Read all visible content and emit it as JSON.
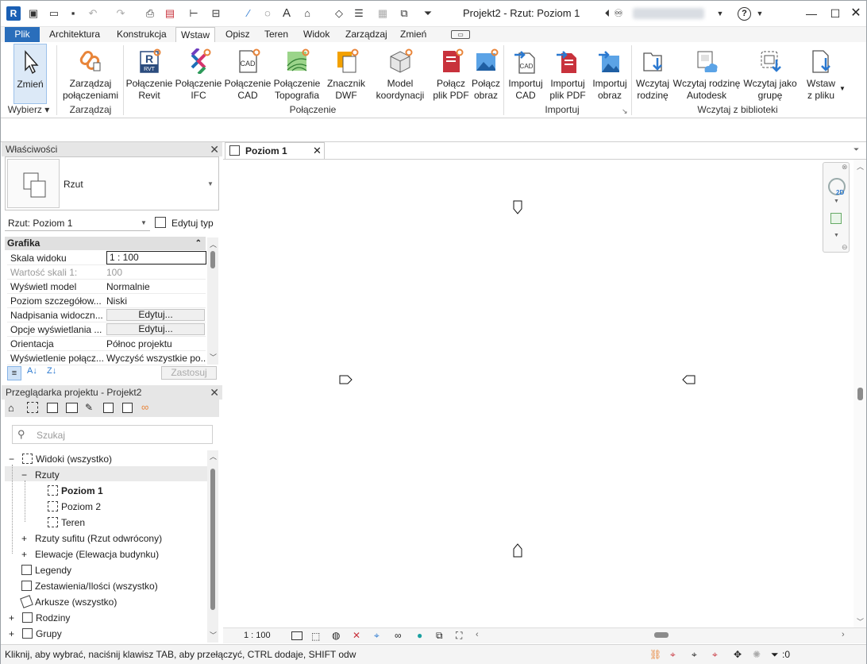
{
  "titlebar": {
    "app_badge": "R",
    "title": "Projekt2 - Rzut: Poziom 1",
    "help_symbol": "?",
    "text_tool_letter": "A"
  },
  "ribbon_tabs": [
    "Plik",
    "Architektura",
    "Konstrukcja",
    "Wstaw",
    "Opisz",
    "Teren",
    "Widok",
    "Zarządzaj",
    "Zmień"
  ],
  "active_tab": "Wstaw",
  "ribbon": {
    "buttons": {
      "modify": "Zmień",
      "manage_links": "Zarządzaj\npołączeniami",
      "link_revit": "Połączenie\nRevit",
      "link_ifc": "Połączenie\nIFC",
      "link_cad": "Połączenie\nCAD",
      "link_topo": "Połączenie\nTopografia",
      "dwf_markup": "Znacznik\nDWF",
      "coord_model": "Model\nkoordynacji",
      "link_pdf": "Połącz\nplik PDF",
      "link_image": "Połącz\nobraz",
      "import_cad": "Importuj\nCAD",
      "import_pdf": "Importuj\nplik PDF",
      "import_image": "Importuj\nobraz",
      "load_family": "Wczytaj\nrodzinę",
      "load_autodesk": "Wczytaj rodzinę\nAutodesk",
      "load_group": "Wczytaj jako\ngrupę",
      "insert_file": "Wstaw\nz pliku"
    },
    "groups": {
      "select": "Wybierz",
      "manage": "Zarządzaj",
      "link": "Połączenie",
      "import": "Importuj",
      "library": "Wczytaj z biblioteki"
    },
    "icon_text": {
      "rvt": "RVT",
      "cad": "CAD"
    }
  },
  "properties": {
    "header": "Właściwości",
    "type_name": "Rzut",
    "instance_selector": "Rzut: Poziom 1",
    "edit_type": "Edytuj typ",
    "section": "Grafika",
    "rows": [
      {
        "key": "Skala widoku",
        "value": "1 : 100"
      },
      {
        "key": "Wartość skali    1:",
        "value": "100"
      },
      {
        "key": "Wyświetl model",
        "value": "Normalnie"
      },
      {
        "key": "Poziom szczegółow...",
        "value": "Niski"
      },
      {
        "key": "Nadpisania widoczn...",
        "value": "Edytuj..."
      },
      {
        "key": "Opcje wyświetlania ...",
        "value": "Edytuj..."
      },
      {
        "key": "Orientacja",
        "value": "Północ projektu"
      },
      {
        "key": "Wyświetlenie połącz...",
        "value": "Wyczyść wszystkie po..."
      }
    ],
    "apply": "Zastosuj"
  },
  "browser": {
    "header": "Przeglądarka projektu - Projekt2",
    "search_placeholder": "Szukaj",
    "items": [
      {
        "label": "Widoki (wszystko)"
      },
      {
        "label": "Rzuty"
      },
      {
        "label": "Poziom 1"
      },
      {
        "label": "Poziom 2"
      },
      {
        "label": "Teren"
      },
      {
        "label": "Rzuty sufitu (Rzut odwrócony)"
      },
      {
        "label": "Elewacje (Elewacja budynku)"
      },
      {
        "label": "Legendy"
      },
      {
        "label": "Zestawienia/Ilości (wszystko)"
      },
      {
        "label": "Arkusze (wszystko)"
      },
      {
        "label": "Rodziny"
      },
      {
        "label": "Grupy"
      }
    ]
  },
  "view": {
    "tab_label": "Poziom 1",
    "scale": "1 : 100",
    "nav_label": "2D"
  },
  "status": {
    "message": "Kliknij, aby wybrać, naciśnij klawisz TAB, aby przełączyć, CTRL dodaje, SHIFT odw",
    "filter_count": ":0"
  },
  "colors": {
    "accent": "#2a6ebb",
    "link_orange": "#e8853a",
    "import_blue": "#2b79d0",
    "pdf_red": "#c8323c"
  }
}
